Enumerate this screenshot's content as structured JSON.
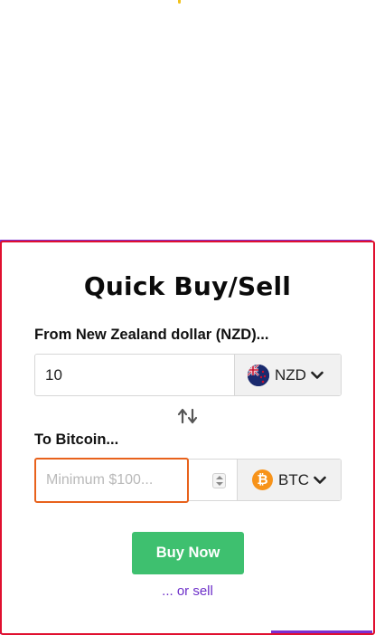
{
  "widget": {
    "title": "Quick Buy/Sell",
    "from": {
      "label": "From New Zealand dollar (NZD)...",
      "amount": "10",
      "currency_code": "NZD",
      "flag_icon": "nz-flag-icon"
    },
    "to": {
      "label": "To Bitcoin...",
      "placeholder": "Minimum $100...",
      "currency_code": "BTC",
      "coin_icon": "bitcoin-icon",
      "coin_symbol": "₿"
    },
    "buy_button": "Buy Now",
    "sell_link": "... or sell"
  },
  "colors": {
    "accent_green": "#3ec06f",
    "border_red": "#e0102f",
    "focus_orange": "#e8621c",
    "link_purple": "#6d2fc9",
    "bitcoin_orange": "#f7931a"
  }
}
